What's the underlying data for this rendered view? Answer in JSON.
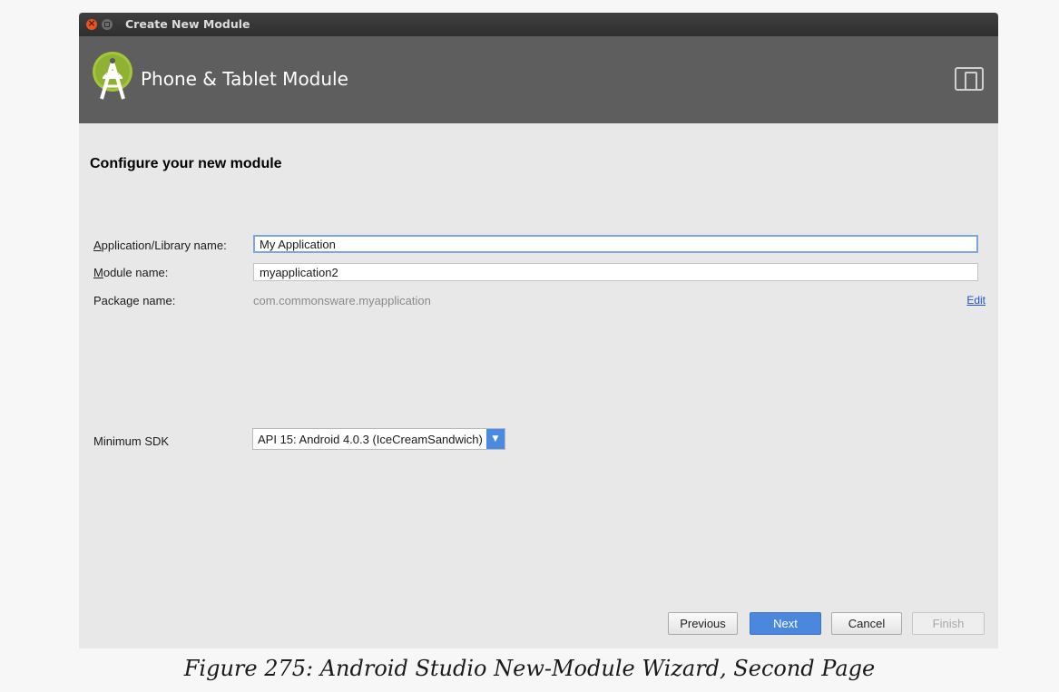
{
  "window": {
    "title": "Create New Module"
  },
  "header": {
    "title": "Phone & Tablet Module",
    "logo_icon": "android-studio-icon",
    "device_icon": "phone-tablet-icon"
  },
  "page": {
    "section_title": "Configure your new module"
  },
  "form": {
    "app_name": {
      "label_mnemonic": "A",
      "label_rest": "pplication/Library name:",
      "value": "My Application"
    },
    "module_name": {
      "label_mnemonic": "M",
      "label_rest": "odule name:",
      "value": "myapplication2"
    },
    "package_name": {
      "label": "Package name:",
      "value": "com.commonsware.myapplication",
      "edit_label": "Edit"
    },
    "min_sdk": {
      "label": "Minimum SDK",
      "selected": "API 15: Android 4.0.3 (IceCreamSandwich)"
    }
  },
  "buttons": {
    "previous": "Previous",
    "next": "Next",
    "cancel": "Cancel",
    "finish": "Finish"
  },
  "caption": "Figure 275: Android Studio New-Module Wizard, Second Page",
  "colors": {
    "header_bg": "#5e5e5e",
    "accent": "#4a87dd",
    "link": "#2450c8",
    "android_green": "#a4c639"
  }
}
